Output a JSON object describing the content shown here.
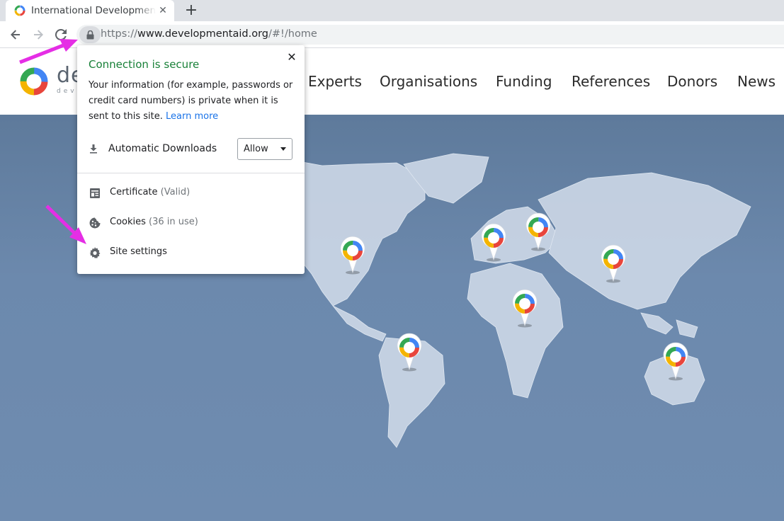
{
  "browser": {
    "tab": {
      "title": "International Development",
      "close_glyph": "✕"
    },
    "new_tab_glyph": "+",
    "url": {
      "scheme": "https://",
      "host": "www.developmentaid.org",
      "path": "/#!/home"
    },
    "icons": [
      "back-icon",
      "forward-icon",
      "reload-icon",
      "lock-icon"
    ]
  },
  "site": {
    "logo_text": "de",
    "logo_sub": "deve",
    "nav": [
      "Experts",
      "Organisations",
      "Funding",
      "References",
      "Donors",
      "News"
    ]
  },
  "popup": {
    "title": "Connection is secure",
    "description": "Your information (for example, passwords or credit card numbers) is private when it is sent to this site.",
    "learn_more": "Learn more",
    "permission": {
      "label": "Automatic Downloads",
      "value": "Allow"
    },
    "certificate": {
      "label": "Certificate",
      "status": "(Valid)"
    },
    "cookies": {
      "label": "Cookies",
      "status": "(36 in use)"
    },
    "site_settings": "Site settings",
    "close_glyph": "✕"
  },
  "colors": {
    "secure_green": "#188038",
    "link_blue": "#1a73e8",
    "annotation_magenta": "#e52ee5",
    "map_background": "#6c89ad",
    "land": "#c8d4e4"
  }
}
